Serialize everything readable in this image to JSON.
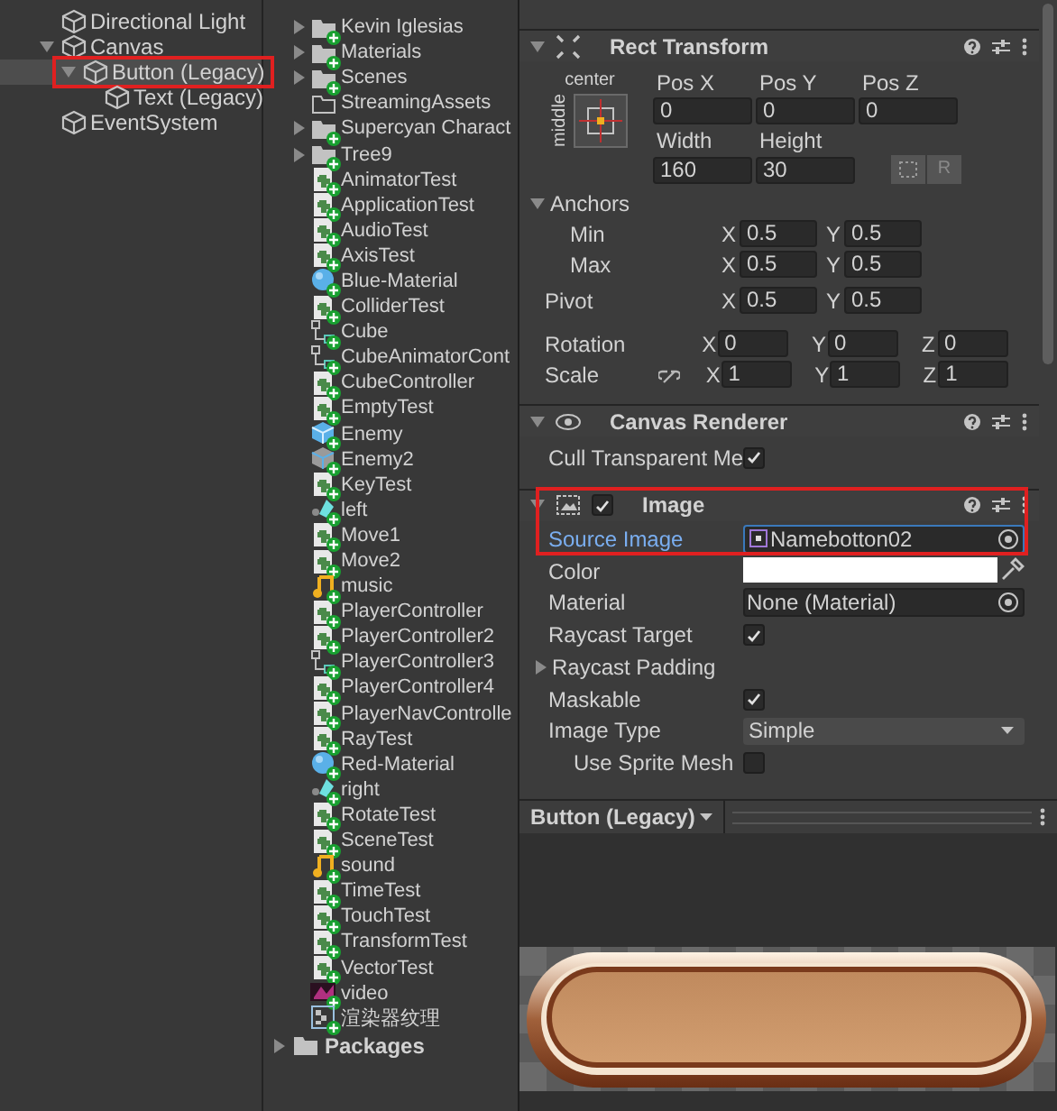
{
  "hierarchy": {
    "items": [
      {
        "label": "Directional Light",
        "selected": false
      },
      {
        "label": "Canvas",
        "selected": false,
        "expanded": true,
        "children": [
          {
            "label": "Button (Legacy)",
            "selected": true,
            "annotated": true,
            "expanded": true,
            "children": [
              {
                "label": "Text (Legacy)",
                "selected": false
              }
            ]
          }
        ]
      },
      {
        "label": "EventSystem",
        "selected": false
      }
    ]
  },
  "project": {
    "items": [
      {
        "label": "Kevin Iglesias",
        "kind": "folder",
        "vcs_added": true
      },
      {
        "label": "Materials",
        "kind": "folder",
        "vcs_added": true
      },
      {
        "label": "Scenes",
        "kind": "folder",
        "vcs_added": true
      },
      {
        "label": "StreamingAssets",
        "kind": "empty-folder",
        "vcs_added": false
      },
      {
        "label": "Supercyan Charact",
        "kind": "folder",
        "vcs_added": true
      },
      {
        "label": "Tree9",
        "kind": "folder",
        "vcs_added": true
      },
      {
        "label": "AnimatorTest",
        "kind": "script",
        "vcs_added": true
      },
      {
        "label": "ApplicationTest",
        "kind": "script",
        "vcs_added": true
      },
      {
        "label": "AudioTest",
        "kind": "script",
        "vcs_added": true
      },
      {
        "label": "AxisTest",
        "kind": "script",
        "vcs_added": true
      },
      {
        "label": "Blue-Material",
        "kind": "material",
        "vcs_added": true
      },
      {
        "label": "ColliderTest",
        "kind": "script",
        "vcs_added": true
      },
      {
        "label": "Cube",
        "kind": "animator",
        "vcs_added": true
      },
      {
        "label": "CubeAnimatorCont",
        "kind": "animator",
        "vcs_added": true
      },
      {
        "label": "CubeController",
        "kind": "script",
        "vcs_added": true
      },
      {
        "label": "EmptyTest",
        "kind": "script",
        "vcs_added": true
      },
      {
        "label": "Enemy",
        "kind": "prefab",
        "vcs_added": true
      },
      {
        "label": "Enemy2",
        "kind": "model",
        "vcs_added": true
      },
      {
        "label": "KeyTest",
        "kind": "script",
        "vcs_added": true
      },
      {
        "label": "left",
        "kind": "clip",
        "vcs_added": true
      },
      {
        "label": "Move1",
        "kind": "script",
        "vcs_added": true
      },
      {
        "label": "Move2",
        "kind": "script",
        "vcs_added": true
      },
      {
        "label": "music",
        "kind": "audio",
        "vcs_added": true
      },
      {
        "label": "PlayerController",
        "kind": "script",
        "vcs_added": true
      },
      {
        "label": "PlayerController2",
        "kind": "script",
        "vcs_added": true
      },
      {
        "label": "PlayerController3",
        "kind": "animator",
        "vcs_added": true
      },
      {
        "label": "PlayerController4",
        "kind": "script",
        "vcs_added": true
      },
      {
        "label": "PlayerNavControlle",
        "kind": "script",
        "vcs_added": true
      },
      {
        "label": "RayTest",
        "kind": "script",
        "vcs_added": true
      },
      {
        "label": "Red-Material",
        "kind": "material",
        "vcs_added": true
      },
      {
        "label": "right",
        "kind": "clip",
        "vcs_added": true
      },
      {
        "label": "RotateTest",
        "kind": "script",
        "vcs_added": true
      },
      {
        "label": "SceneTest",
        "kind": "script",
        "vcs_added": true
      },
      {
        "label": "sound",
        "kind": "audio",
        "vcs_added": true
      },
      {
        "label": "TimeTest",
        "kind": "script",
        "vcs_added": true
      },
      {
        "label": "TouchTest",
        "kind": "script",
        "vcs_added": true
      },
      {
        "label": "TransformTest",
        "kind": "script",
        "vcs_added": true
      },
      {
        "label": "VectorTest",
        "kind": "script",
        "vcs_added": true
      },
      {
        "label": "video",
        "kind": "video",
        "vcs_added": true
      },
      {
        "label": "渲染器纹理",
        "kind": "render-texture",
        "vcs_added": true
      }
    ],
    "packages": {
      "label": "Packages",
      "expanded": false
    }
  },
  "inspector": {
    "rect_transform": {
      "title": "Rect Transform",
      "expanded": true,
      "anchor_preset": {
        "horizontal": "center",
        "vertical": "middle"
      },
      "position": [
        {
          "label": "Pos X",
          "value": "0"
        },
        {
          "label": "Pos Y",
          "value": "0"
        },
        {
          "label": "Pos Z",
          "value": "0"
        }
      ],
      "size": [
        {
          "label": "Width",
          "value": "160"
        },
        {
          "label": "Height",
          "value": "30"
        }
      ],
      "raw_button": "R",
      "anchors": {
        "label": "Anchors",
        "expanded": true,
        "rows": [
          {
            "label": "Min",
            "fields": [
              {
                "axis": "X",
                "value": "0.5"
              },
              {
                "axis": "Y",
                "value": "0.5"
              }
            ]
          },
          {
            "label": "Max",
            "fields": [
              {
                "axis": "X",
                "value": "0.5"
              },
              {
                "axis": "Y",
                "value": "0.5"
              }
            ]
          }
        ]
      },
      "pivot": {
        "label": "Pivot",
        "fields": [
          {
            "axis": "X",
            "value": "0.5"
          },
          {
            "axis": "Y",
            "value": "0.5"
          }
        ]
      },
      "rotation": {
        "label": "Rotation",
        "fields": [
          {
            "axis": "X",
            "value": "0"
          },
          {
            "axis": "Y",
            "value": "0"
          },
          {
            "axis": "Z",
            "value": "0"
          }
        ]
      },
      "scale": {
        "label": "Scale",
        "fields": [
          {
            "axis": "X",
            "value": "1"
          },
          {
            "axis": "Y",
            "value": "1"
          },
          {
            "axis": "Z",
            "value": "1"
          }
        ]
      }
    },
    "canvas_renderer": {
      "title": "Canvas Renderer",
      "expanded": true,
      "properties": [
        {
          "label": "Cull Transparent Me",
          "kind": "checkbox",
          "checked": true
        }
      ]
    },
    "image": {
      "title": "Image",
      "expanded": true,
      "enabled": true,
      "annotated": true,
      "properties": [
        {
          "label": "Source Image",
          "kind": "object",
          "value": "Namebotton02",
          "highlighted": true
        },
        {
          "label": "Color",
          "kind": "color",
          "color": "#ffffff"
        },
        {
          "label": "Material",
          "kind": "object",
          "value": "None (Material)",
          "highlighted": false
        },
        {
          "label": "Raycast Target",
          "kind": "checkbox",
          "checked": true
        },
        {
          "label": "Raycast Padding",
          "kind": "foldout",
          "expanded": false
        },
        {
          "label": "Maskable",
          "kind": "checkbox",
          "checked": true
        },
        {
          "label": "Image Type",
          "kind": "dropdown",
          "value": "Simple"
        },
        {
          "label": "Use Sprite Mesh",
          "kind": "checkbox",
          "checked": false,
          "indented": true
        }
      ]
    },
    "preview": {
      "title": "Button (Legacy)"
    }
  }
}
